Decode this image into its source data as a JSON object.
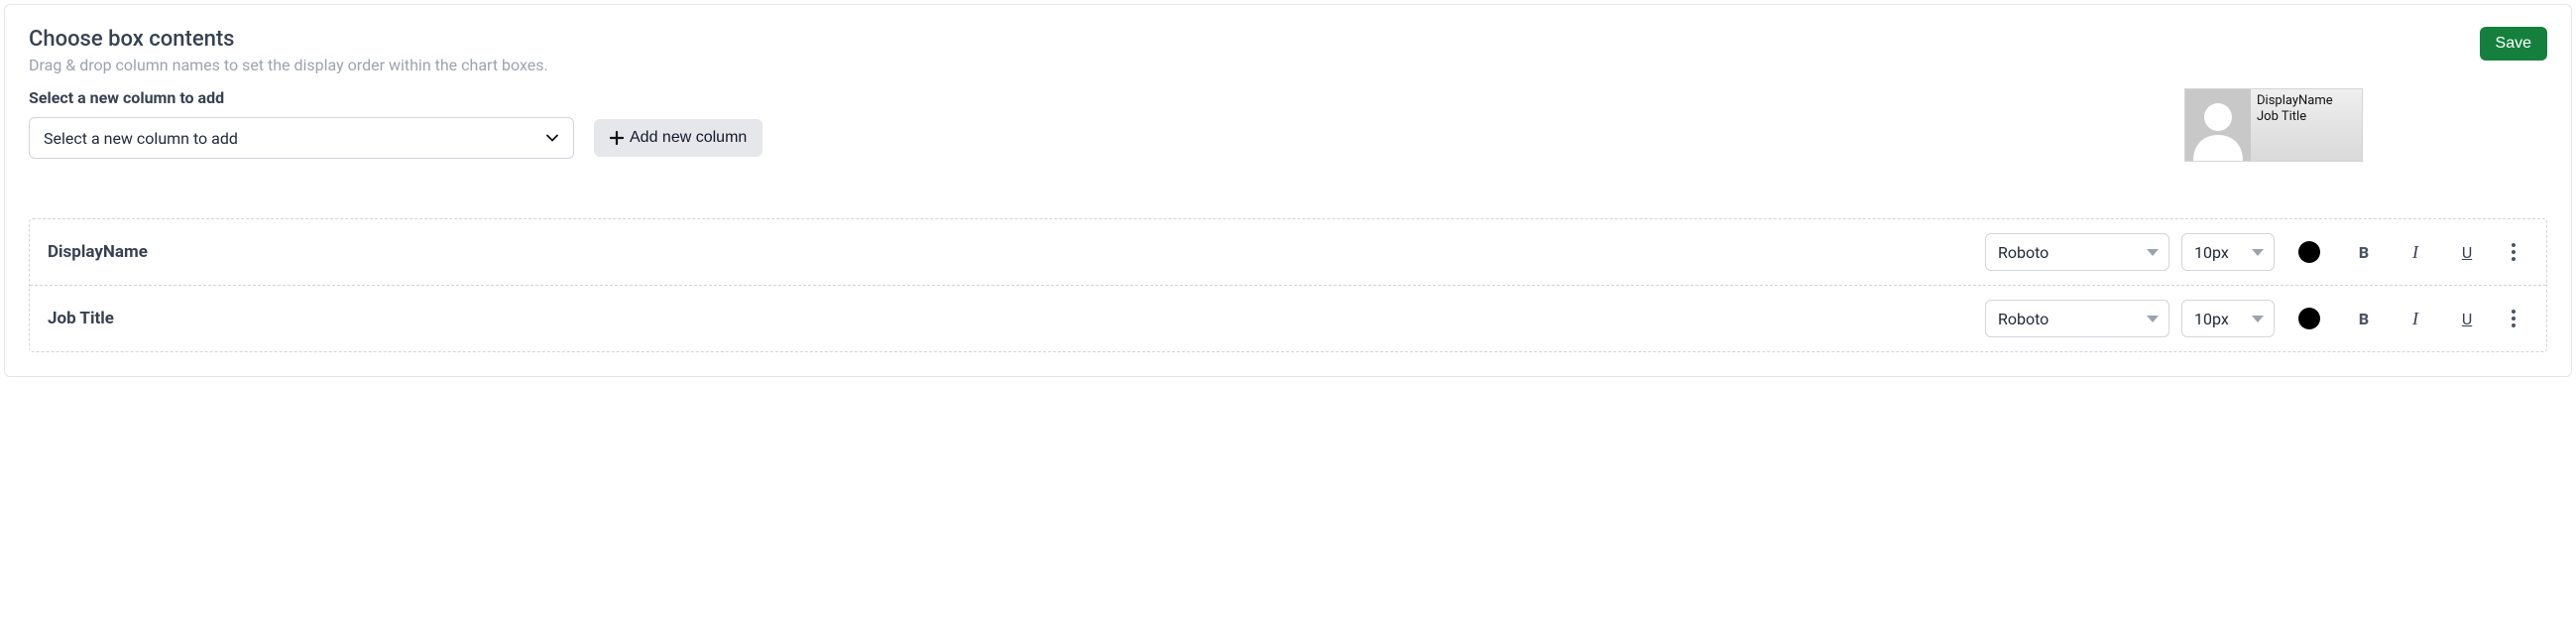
{
  "header": {
    "title": "Choose box contents",
    "subtitle": "Drag & drop column names to set the display order within the chart boxes.",
    "save_label": "Save"
  },
  "add_section": {
    "label": "Select a new column to add",
    "select_placeholder": "Select a new column to add",
    "add_button_label": "Add new column"
  },
  "preview": {
    "line1": "DisplayName",
    "line2": "Job Title"
  },
  "rows": [
    {
      "name": "DisplayName",
      "font": "Roboto",
      "size": "10px",
      "color": "#000000"
    },
    {
      "name": "Job Title",
      "font": "Roboto",
      "size": "10px",
      "color": "#000000"
    }
  ],
  "fmt": {
    "bold": "B",
    "italic": "I",
    "underline": "U"
  }
}
